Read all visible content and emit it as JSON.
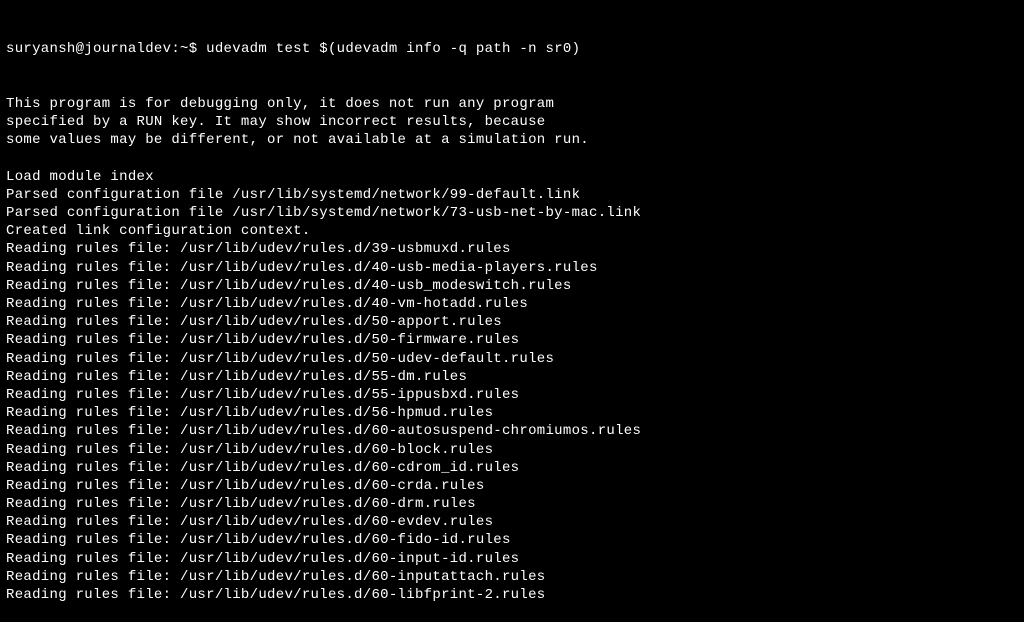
{
  "prompt": {
    "user_host": "suryansh@journaldev",
    "separator": ":",
    "path": "~",
    "symbol": "$"
  },
  "command": "udevadm test $(udevadm info -q path -n sr0)",
  "output_lines": [
    "This program is for debugging only, it does not run any program",
    "specified by a RUN key. It may show incorrect results, because",
    "some values may be different, or not available at a simulation run.",
    "",
    "Load module index",
    "Parsed configuration file /usr/lib/systemd/network/99-default.link",
    "Parsed configuration file /usr/lib/systemd/network/73-usb-net-by-mac.link",
    "Created link configuration context.",
    "Reading rules file: /usr/lib/udev/rules.d/39-usbmuxd.rules",
    "Reading rules file: /usr/lib/udev/rules.d/40-usb-media-players.rules",
    "Reading rules file: /usr/lib/udev/rules.d/40-usb_modeswitch.rules",
    "Reading rules file: /usr/lib/udev/rules.d/40-vm-hotadd.rules",
    "Reading rules file: /usr/lib/udev/rules.d/50-apport.rules",
    "Reading rules file: /usr/lib/udev/rules.d/50-firmware.rules",
    "Reading rules file: /usr/lib/udev/rules.d/50-udev-default.rules",
    "Reading rules file: /usr/lib/udev/rules.d/55-dm.rules",
    "Reading rules file: /usr/lib/udev/rules.d/55-ippusbxd.rules",
    "Reading rules file: /usr/lib/udev/rules.d/56-hpmud.rules",
    "Reading rules file: /usr/lib/udev/rules.d/60-autosuspend-chromiumos.rules",
    "Reading rules file: /usr/lib/udev/rules.d/60-block.rules",
    "Reading rules file: /usr/lib/udev/rules.d/60-cdrom_id.rules",
    "Reading rules file: /usr/lib/udev/rules.d/60-crda.rules",
    "Reading rules file: /usr/lib/udev/rules.d/60-drm.rules",
    "Reading rules file: /usr/lib/udev/rules.d/60-evdev.rules",
    "Reading rules file: /usr/lib/udev/rules.d/60-fido-id.rules",
    "Reading rules file: /usr/lib/udev/rules.d/60-input-id.rules",
    "Reading rules file: /usr/lib/udev/rules.d/60-inputattach.rules",
    "Reading rules file: /usr/lib/udev/rules.d/60-libfprint-2.rules"
  ]
}
